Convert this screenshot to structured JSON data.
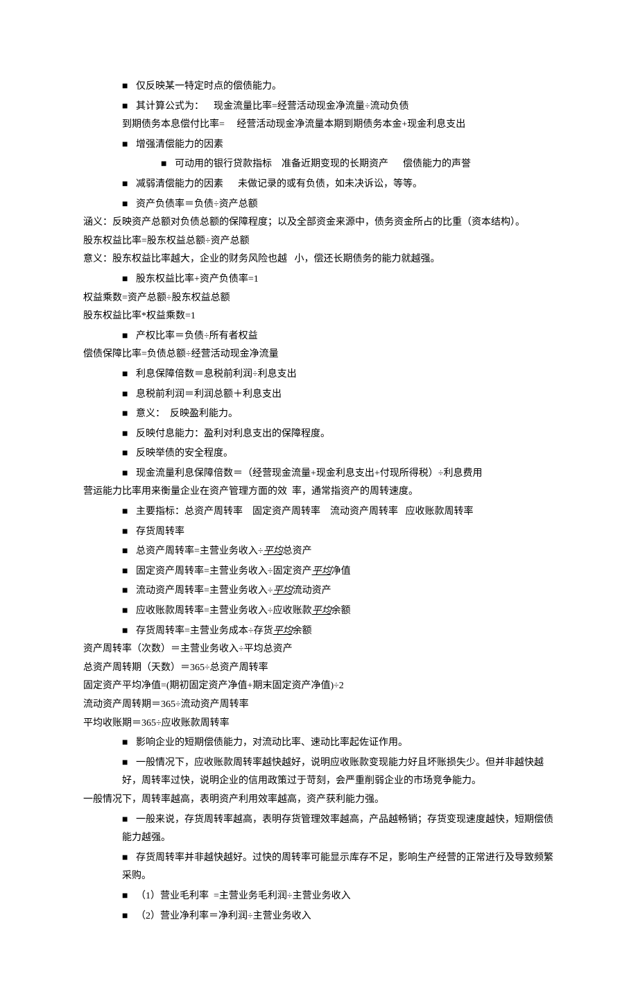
{
  "lines": [
    {
      "cls": "b1",
      "bullet": true,
      "parts": [
        {
          "t": "txt",
          "v": "仅反映某一特定时点的偿债能力。"
        }
      ]
    },
    {
      "cls": "b1",
      "bullet": true,
      "parts": [
        {
          "t": "txt",
          "v": "其计算公式为：    现金流量比率=经营活动现金净流量÷流动负债"
        }
      ]
    },
    {
      "cls": "ind1",
      "bullet": false,
      "parts": [
        {
          "t": "txt",
          "v": "到期债务本息偿付比率=     经营活动现金净流量本期到期债务本金+现金利息支出"
        }
      ]
    },
    {
      "cls": "b1",
      "bullet": true,
      "parts": [
        {
          "t": "txt",
          "v": "增强清偿能力的因素"
        }
      ]
    },
    {
      "cls": "b2",
      "bullet": true,
      "parts": [
        {
          "t": "txt",
          "v": "可动用的银行贷款指标    准备近期变现的长期资产      偿债能力的声誉"
        }
      ]
    },
    {
      "cls": "b1",
      "bullet": true,
      "parts": [
        {
          "t": "txt",
          "v": "减弱清偿能力的因素      未做记录的或有负债，如未决诉讼，等等。"
        }
      ]
    },
    {
      "cls": "b1",
      "bullet": true,
      "parts": [
        {
          "t": "txt",
          "v": "资产负债率＝负债÷资产总额"
        }
      ]
    },
    {
      "cls": "",
      "bullet": false,
      "parts": [
        {
          "t": "txt",
          "v": "涵义：反映资产总额对负债总额的保障程度；以及全部资金来源中，债务资金所占的比重（资本结构）。"
        }
      ]
    },
    {
      "cls": "",
      "bullet": false,
      "parts": [
        {
          "t": "txt",
          "v": "股东权益比率=股东权益总额÷资产总额"
        }
      ]
    },
    {
      "cls": "",
      "bullet": false,
      "parts": [
        {
          "t": "txt",
          "v": "意义：股东权益比率越大，企业的财务风险也越   小，偿还长期债务的能力就越强。"
        }
      ]
    },
    {
      "cls": "b1",
      "bullet": true,
      "parts": [
        {
          "t": "txt",
          "v": "股东权益比率+资产负债率=1"
        }
      ]
    },
    {
      "cls": "",
      "bullet": false,
      "parts": [
        {
          "t": "txt",
          "v": "权益乘数=资产总额÷股东权益总额"
        }
      ]
    },
    {
      "cls": "",
      "bullet": false,
      "parts": [
        {
          "t": "txt",
          "v": "股东权益比率*权益乘数=1"
        }
      ]
    },
    {
      "cls": "b1",
      "bullet": true,
      "parts": [
        {
          "t": "txt",
          "v": "产权比率＝负债÷所有者权益"
        }
      ]
    },
    {
      "cls": "",
      "bullet": false,
      "parts": [
        {
          "t": "txt",
          "v": "偿债保障比率=负债总额÷经营活动现金净流量"
        }
      ]
    },
    {
      "cls": "b1",
      "bullet": true,
      "parts": [
        {
          "t": "txt",
          "v": "利息保障倍数＝息税前利润÷利息支出"
        }
      ]
    },
    {
      "cls": "b1",
      "bullet": true,
      "parts": [
        {
          "t": "txt",
          "v": "息税前利润＝利润总额＋利息支出"
        }
      ]
    },
    {
      "cls": "b1",
      "bullet": true,
      "parts": [
        {
          "t": "txt",
          "v": "意义：  反映盈利能力。"
        }
      ]
    },
    {
      "cls": "b1",
      "bullet": true,
      "parts": [
        {
          "t": "txt",
          "v": "反映付息能力：盈利对利息支出的保障程度。"
        }
      ]
    },
    {
      "cls": "b1",
      "bullet": true,
      "parts": [
        {
          "t": "txt",
          "v": "反映举债的安全程度。"
        }
      ]
    },
    {
      "cls": "b1",
      "bullet": true,
      "parts": [
        {
          "t": "txt",
          "v": "现金流量利息保障倍数＝（经营现金流量+现金利息支出+付现所得税）÷利息费用"
        }
      ]
    },
    {
      "cls": "",
      "bullet": false,
      "parts": [
        {
          "t": "txt",
          "v": "营运能力比率用来衡量企业在资产管理方面的效  率，通常指资产的周转速度。"
        }
      ]
    },
    {
      "cls": "b1",
      "bullet": true,
      "parts": [
        {
          "t": "txt",
          "v": "主要指标：总资产周转率    固定资产周转率    流动资产周转率   应收账款周转率"
        }
      ]
    },
    {
      "cls": "b1",
      "bullet": true,
      "parts": [
        {
          "t": "txt",
          "v": "存货周转率"
        }
      ]
    },
    {
      "cls": "b1",
      "bullet": true,
      "parts": [
        {
          "t": "txt",
          "v": "总资产周转率=主营业务收入÷"
        },
        {
          "t": "ul",
          "v": "平均"
        },
        {
          "t": "txt",
          "v": "总资产"
        }
      ]
    },
    {
      "cls": "b1",
      "bullet": true,
      "parts": [
        {
          "t": "txt",
          "v": "固定资产周转率=主营业务收入÷固定资产"
        },
        {
          "t": "ul",
          "v": "平均"
        },
        {
          "t": "txt",
          "v": "净值"
        }
      ]
    },
    {
      "cls": "b1",
      "bullet": true,
      "parts": [
        {
          "t": "txt",
          "v": "流动资产周转率=主营业务收入÷"
        },
        {
          "t": "ul",
          "v": "平均"
        },
        {
          "t": "txt",
          "v": "流动资产"
        }
      ]
    },
    {
      "cls": "b1",
      "bullet": true,
      "parts": [
        {
          "t": "txt",
          "v": "应收账款周转率=主营业务收入÷应收账款"
        },
        {
          "t": "ul",
          "v": "平均"
        },
        {
          "t": "txt",
          "v": "余额"
        }
      ]
    },
    {
      "cls": "b1",
      "bullet": true,
      "parts": [
        {
          "t": "txt",
          "v": "存货周转率=主营业务成本÷存货"
        },
        {
          "t": "ul",
          "v": "平均"
        },
        {
          "t": "txt",
          "v": "余额"
        }
      ]
    },
    {
      "cls": "",
      "bullet": false,
      "parts": [
        {
          "t": "txt",
          "v": "资产周转率（次数）＝主营业务收入÷平均总资产"
        }
      ]
    },
    {
      "cls": "",
      "bullet": false,
      "parts": [
        {
          "t": "txt",
          "v": "总资产周转期（天数）＝365÷总资产周转率"
        }
      ]
    },
    {
      "cls": "",
      "bullet": false,
      "parts": [
        {
          "t": "txt",
          "v": "固定资产平均净值=(期初固定资产净值+期末固定资产净值)÷2"
        }
      ]
    },
    {
      "cls": "",
      "bullet": false,
      "parts": [
        {
          "t": "txt",
          "v": "流动资产周转期＝365÷流动资产周转率"
        }
      ]
    },
    {
      "cls": "",
      "bullet": false,
      "parts": [
        {
          "t": "txt",
          "v": "平均收账期＝365÷应收账款周转率"
        }
      ]
    },
    {
      "cls": "b1",
      "bullet": true,
      "parts": [
        {
          "t": "txt",
          "v": "影响企业的短期偿债能力，对流动比率、速动比率起佐证作用。"
        }
      ]
    },
    {
      "cls": "b1",
      "bullet": true,
      "parts": [
        {
          "t": "txt",
          "v": "一般情况下，应收账款周转率越快越好，说明应收账款变现能力好且坏账损失少。但并非越快越好，周转率过快，说明企业的信用政策过于苛刻，会严重削弱企业的市场竞争能力。"
        }
      ]
    },
    {
      "cls": "",
      "bullet": false,
      "parts": [
        {
          "t": "txt",
          "v": "一般情况下，周转率越高，表明资产利用效率越高，资产获利能力强。"
        }
      ]
    },
    {
      "cls": "b1",
      "bullet": true,
      "parts": [
        {
          "t": "txt",
          "v": "一般来说，存货周转率越高，表明存货管理效率越高，产品越畅销；存货变现速度越快，短期偿债能力越强。"
        }
      ]
    },
    {
      "cls": "b1",
      "bullet": true,
      "parts": [
        {
          "t": "txt",
          "v": "存货周转率并非越快越好。过快的周转率可能显示库存不足，影响生产经营的正常进行及导致频繁采购。"
        }
      ]
    },
    {
      "cls": "b1",
      "bullet": true,
      "parts": [
        {
          "t": "txt",
          "v": "（1）营业毛利率  =主营业务毛利润÷主营业务收入"
        }
      ]
    },
    {
      "cls": "b1",
      "bullet": true,
      "parts": [
        {
          "t": "txt",
          "v": "（2）营业净利率＝净利润÷主营业务收入"
        }
      ]
    }
  ]
}
